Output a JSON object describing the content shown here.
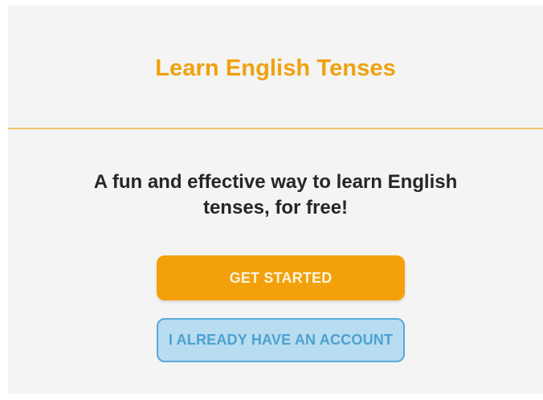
{
  "header": {
    "title": "Learn English Tenses"
  },
  "main": {
    "tagline": "A fun and effective way to learn English tenses, for free!",
    "get_started_label": "GET STARTED",
    "have_account_label": "I ALREADY HAVE AN ACCOUNT"
  },
  "colors": {
    "accent": "#f3a00a",
    "title": "#f0a10c",
    "divider": "#efc46a",
    "secondary_bg": "#b8dcf0",
    "secondary_text": "#4ba2d2",
    "background": "#f4f4f4"
  }
}
